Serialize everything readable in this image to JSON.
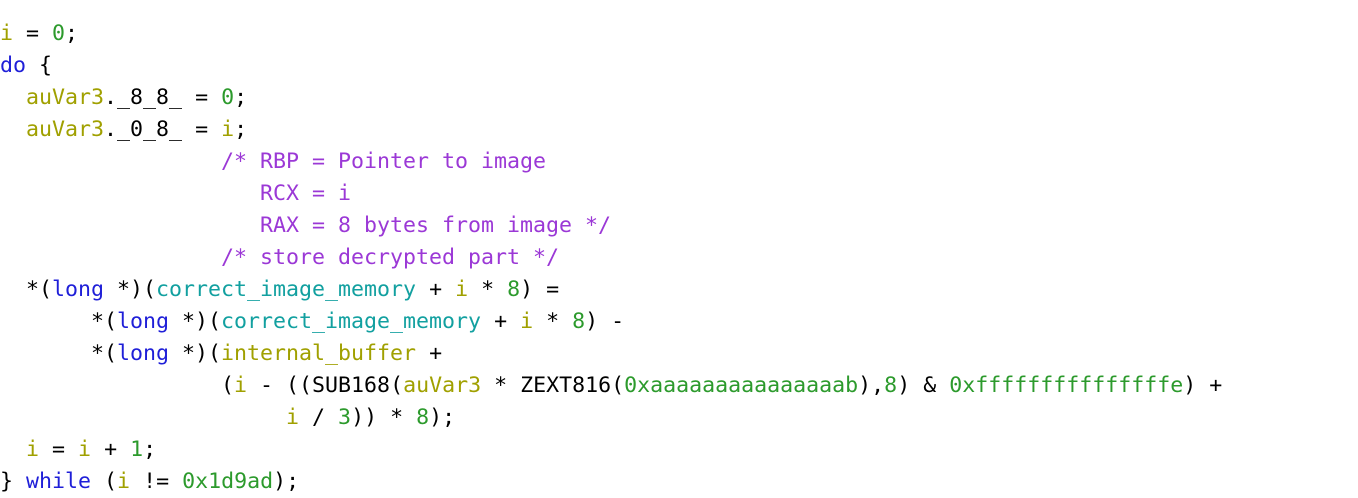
{
  "window": {
    "title": "",
    "kind": "decompiler-listing"
  },
  "palette": {
    "background": "#ffffff",
    "plain": "#000000",
    "local_variable": "#a0a000",
    "constant": "#2c9a2c",
    "keyword": "#1f1fd8",
    "type": "#1f1fd8",
    "comment": "#9b38d6",
    "global": "#12a0a0"
  },
  "code": {
    "lines": [
      {
        "tokens": [
          {
            "t": "",
            "k": "txt"
          }
        ]
      },
      {
        "tokens": [
          {
            "t": "i",
            "k": "var"
          },
          {
            "t": " = ",
            "k": "txt"
          },
          {
            "t": "0",
            "k": "num"
          },
          {
            "t": ";",
            "k": "txt"
          }
        ]
      },
      {
        "tokens": [
          {
            "t": "do",
            "k": "kw"
          },
          {
            "t": " {",
            "k": "txt"
          }
        ]
      },
      {
        "tokens": [
          {
            "t": "  ",
            "k": "txt"
          },
          {
            "t": "auVar3",
            "k": "var"
          },
          {
            "t": ".",
            "k": "txt"
          },
          {
            "t": "_8_8_",
            "k": "txt"
          },
          {
            "t": " = ",
            "k": "txt"
          },
          {
            "t": "0",
            "k": "num"
          },
          {
            "t": ";",
            "k": "txt"
          }
        ]
      },
      {
        "tokens": [
          {
            "t": "  ",
            "k": "txt"
          },
          {
            "t": "auVar3",
            "k": "var"
          },
          {
            "t": ".",
            "k": "txt"
          },
          {
            "t": "_0_8_",
            "k": "txt"
          },
          {
            "t": " = ",
            "k": "txt"
          },
          {
            "t": "i",
            "k": "var"
          },
          {
            "t": ";",
            "k": "txt"
          }
        ]
      },
      {
        "tokens": [
          {
            "t": "                 ",
            "k": "txt"
          },
          {
            "t": "/* RBP = Pointer to image",
            "k": "cmt"
          }
        ]
      },
      {
        "tokens": [
          {
            "t": "                    ",
            "k": "txt"
          },
          {
            "t": "RCX = i",
            "k": "cmt"
          }
        ]
      },
      {
        "tokens": [
          {
            "t": "                    ",
            "k": "txt"
          },
          {
            "t": "RAX = 8 bytes from image */",
            "k": "cmt"
          }
        ]
      },
      {
        "tokens": [
          {
            "t": "                 ",
            "k": "txt"
          },
          {
            "t": "/* store decrypted part */",
            "k": "cmt"
          }
        ]
      },
      {
        "tokens": [
          {
            "t": "  *(",
            "k": "txt"
          },
          {
            "t": "long",
            "k": "type"
          },
          {
            "t": " *)(",
            "k": "txt"
          },
          {
            "t": "correct_image_memory",
            "k": "glob"
          },
          {
            "t": " + ",
            "k": "txt"
          },
          {
            "t": "i",
            "k": "var"
          },
          {
            "t": " * ",
            "k": "txt"
          },
          {
            "t": "8",
            "k": "num"
          },
          {
            "t": ") =",
            "k": "txt"
          }
        ]
      },
      {
        "tokens": [
          {
            "t": "       *(",
            "k": "txt"
          },
          {
            "t": "long",
            "k": "type"
          },
          {
            "t": " *)(",
            "k": "txt"
          },
          {
            "t": "correct_image_memory",
            "k": "glob"
          },
          {
            "t": " + ",
            "k": "txt"
          },
          {
            "t": "i",
            "k": "var"
          },
          {
            "t": " * ",
            "k": "txt"
          },
          {
            "t": "8",
            "k": "num"
          },
          {
            "t": ") -",
            "k": "txt"
          }
        ]
      },
      {
        "tokens": [
          {
            "t": "       *(",
            "k": "txt"
          },
          {
            "t": "long",
            "k": "type"
          },
          {
            "t": " *)(",
            "k": "txt"
          },
          {
            "t": "internal_buffer",
            "k": "var"
          },
          {
            "t": " +",
            "k": "txt"
          }
        ]
      },
      {
        "tokens": [
          {
            "t": "                 (",
            "k": "txt"
          },
          {
            "t": "i",
            "k": "var"
          },
          {
            "t": " - ((",
            "k": "txt"
          },
          {
            "t": "SUB168",
            "k": "fn"
          },
          {
            "t": "(",
            "k": "txt"
          },
          {
            "t": "auVar3",
            "k": "var"
          },
          {
            "t": " * ",
            "k": "txt"
          },
          {
            "t": "ZEXT816",
            "k": "fn"
          },
          {
            "t": "(",
            "k": "txt"
          },
          {
            "t": "0xaaaaaaaaaaaaaaab",
            "k": "num"
          },
          {
            "t": "),",
            "k": "txt"
          },
          {
            "t": "8",
            "k": "num"
          },
          {
            "t": ") & ",
            "k": "txt"
          },
          {
            "t": "0xfffffffffffffffe",
            "k": "num"
          },
          {
            "t": ") +",
            "k": "txt"
          }
        ]
      },
      {
        "tokens": [
          {
            "t": "                      ",
            "k": "txt"
          },
          {
            "t": "i",
            "k": "var"
          },
          {
            "t": " / ",
            "k": "txt"
          },
          {
            "t": "3",
            "k": "num"
          },
          {
            "t": ")) * ",
            "k": "txt"
          },
          {
            "t": "8",
            "k": "num"
          },
          {
            "t": ");",
            "k": "txt"
          }
        ]
      },
      {
        "tokens": [
          {
            "t": "  ",
            "k": "txt"
          },
          {
            "t": "i",
            "k": "var"
          },
          {
            "t": " = ",
            "k": "txt"
          },
          {
            "t": "i",
            "k": "var"
          },
          {
            "t": " + ",
            "k": "txt"
          },
          {
            "t": "1",
            "k": "num"
          },
          {
            "t": ";",
            "k": "txt"
          }
        ]
      },
      {
        "tokens": [
          {
            "t": "} ",
            "k": "txt"
          },
          {
            "t": "while",
            "k": "kw"
          },
          {
            "t": " (",
            "k": "txt"
          },
          {
            "t": "i",
            "k": "var"
          },
          {
            "t": " != ",
            "k": "txt"
          },
          {
            "t": "0x1d9ad",
            "k": "num"
          },
          {
            "t": ");",
            "k": "txt"
          }
        ]
      }
    ]
  }
}
